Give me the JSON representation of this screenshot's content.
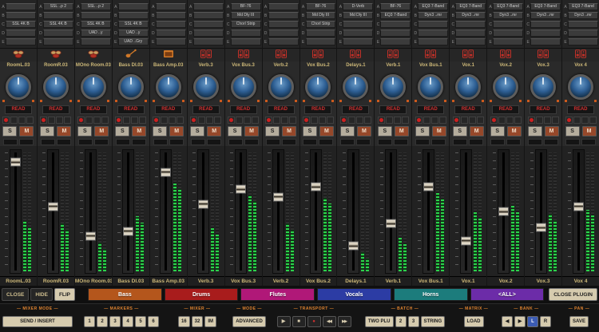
{
  "strip_letters": [
    "A",
    "B",
    "C",
    "D",
    "E"
  ],
  "strip_controls": {
    "automation": "READ",
    "solo": "S",
    "mute": "M"
  },
  "channels": [
    {
      "name": "RoomL.03",
      "icon": "drums",
      "inserts": [
        "",
        "",
        "SSL 4K B",
        "",
        ""
      ],
      "fader": 10,
      "meter": 42
    },
    {
      "name": "RoomR.03",
      "icon": "drums",
      "inserts": [
        "SSL ..p 2",
        "",
        "SSL 4K B",
        "",
        ""
      ],
      "fader": 46,
      "meter": 40
    },
    {
      "name": "MOno Room.03",
      "icon": "drums",
      "inserts": [
        "SSL ..p 2",
        "",
        "SSL 4K B",
        "UAD ..y",
        ""
      ],
      "fader": 70,
      "meter": 24
    },
    {
      "name": "Bass DI.03",
      "icon": "bass",
      "inserts": [
        "",
        "",
        "SSL 4K B",
        "UAD ..y",
        "UAD ..Gry"
      ],
      "fader": 66,
      "meter": 46
    },
    {
      "name": "Bass Amp.03",
      "icon": "amp",
      "inserts": [
        "",
        "",
        "",
        "",
        ""
      ],
      "fader": 18,
      "meter": 74
    },
    {
      "name": "Verb.3",
      "icon": "speakers",
      "inserts": [
        "",
        "",
        "",
        "",
        ""
      ],
      "fader": 44,
      "meter": 36
    },
    {
      "name": "Vox Bus.3",
      "icon": "speakers",
      "inserts": [
        "BF-76",
        "Md Dly III",
        "Chorl Strip",
        "",
        ""
      ],
      "fader": 32,
      "meter": 64
    },
    {
      "name": "Verb.2",
      "icon": "speakers",
      "inserts": [
        "",
        "",
        "",
        "",
        ""
      ],
      "fader": 38,
      "meter": 40
    },
    {
      "name": "Vox Bus.2",
      "icon": "speakers",
      "inserts": [
        "BF-76",
        "Md Dly III",
        "Chorl Strip",
        "",
        ""
      ],
      "fader": 30,
      "meter": 62
    },
    {
      "name": "Delays.1",
      "icon": "speakers",
      "inserts": [
        "D-Verb",
        "Md Dly III",
        "",
        "",
        ""
      ],
      "fader": 78,
      "meter": 16
    },
    {
      "name": "Verb.1",
      "icon": "speakers",
      "inserts": [
        "BF-76",
        "EQ3 7-Band",
        "",
        "",
        ""
      ],
      "fader": 60,
      "meter": 28
    },
    {
      "name": "Vox Bus.1",
      "icon": "speakers",
      "inserts": [
        "EQ3 7-Band",
        "Dyn3 ..mr",
        "",
        "",
        ""
      ],
      "fader": 30,
      "meter": 66
    },
    {
      "name": "Vox.1",
      "icon": "speakers",
      "inserts": [
        "EQ3 7-Band",
        "Dyn3 ..mr",
        "",
        "",
        ""
      ],
      "fader": 74,
      "meter": 50
    },
    {
      "name": "Vox.2",
      "icon": "speakers",
      "inserts": [
        "EQ3 7-Band",
        "Dyn3 ..mr",
        "",
        "",
        ""
      ],
      "fader": 50,
      "meter": 55
    },
    {
      "name": "Vox.3",
      "icon": "speakers",
      "inserts": [
        "EQ3 7-Band",
        "Dyn3 ..mr",
        "",
        "",
        ""
      ],
      "fader": 63,
      "meter": 48
    },
    {
      "name": "Vox 4",
      "icon": "speakers",
      "inserts": [
        "EQ3 7-Band",
        "Dyn3 ..mr",
        "",
        "",
        ""
      ],
      "fader": 46,
      "meter": 52
    }
  ],
  "footer": {
    "close": "CLOSE",
    "hide": "HIDE",
    "flip": "FLIP",
    "groups": [
      {
        "label": "Bass",
        "color": "#b4561c"
      },
      {
        "label": "Drums",
        "color": "#a81c1c"
      },
      {
        "label": "Flutes",
        "color": "#b01878"
      },
      {
        "label": "Vocals",
        "color": "#2c3ca4"
      },
      {
        "label": "Horns",
        "color": "#1c7c7c"
      },
      {
        "label": "<ALL>",
        "color": "#6c2ca8"
      }
    ],
    "close_plugin": "CLOSE PLUGIN"
  },
  "control_bar": {
    "mixer_mode": {
      "label": "MIXER MODE",
      "button": "SEND / INSERT"
    },
    "markers": {
      "label": "MARKERS",
      "buttons": [
        "1",
        "2",
        "3",
        "4",
        "5",
        "6"
      ]
    },
    "mixer": {
      "label": "MIXER",
      "buttons": [
        "16",
        "32",
        "IM"
      ]
    },
    "mode": {
      "label": "MODE",
      "button": "ADVANCED"
    },
    "transport": {
      "label": "TRANSPORT",
      "buttons": [
        {
          "name": "play",
          "glyph": "▶"
        },
        {
          "name": "stop",
          "glyph": "■"
        },
        {
          "name": "record",
          "glyph": "●",
          "color": "#d03030"
        },
        {
          "name": "rewind",
          "glyph": "◀◀"
        },
        {
          "name": "fast-forward",
          "glyph": "▶▶"
        }
      ]
    },
    "batch": {
      "label": "BATCH",
      "buttons": [
        "TWO PLU",
        "2",
        "3",
        "STRING"
      ]
    },
    "matrix": {
      "label": "MATRIX",
      "button": "LOAD"
    },
    "bank": {
      "label": "BANK",
      "buttons": [
        {
          "name": "bank-left",
          "glyph": "◀"
        },
        {
          "name": "bank-right",
          "glyph": "▶"
        },
        {
          "name": "left-channel",
          "glyph": "L",
          "bg": "#3c5cb4",
          "fg": "#ffffff"
        },
        {
          "name": "right-channel",
          "glyph": "R"
        }
      ]
    },
    "pan": {
      "label": "PAN",
      "button": "SAVE"
    }
  },
  "colors": {
    "accent_tan": "#d6cbae",
    "label_orange": "#e08430",
    "automation_red": "#d03030",
    "meter_green": "#2bd34b",
    "knob_blue": "#2e5f94"
  }
}
